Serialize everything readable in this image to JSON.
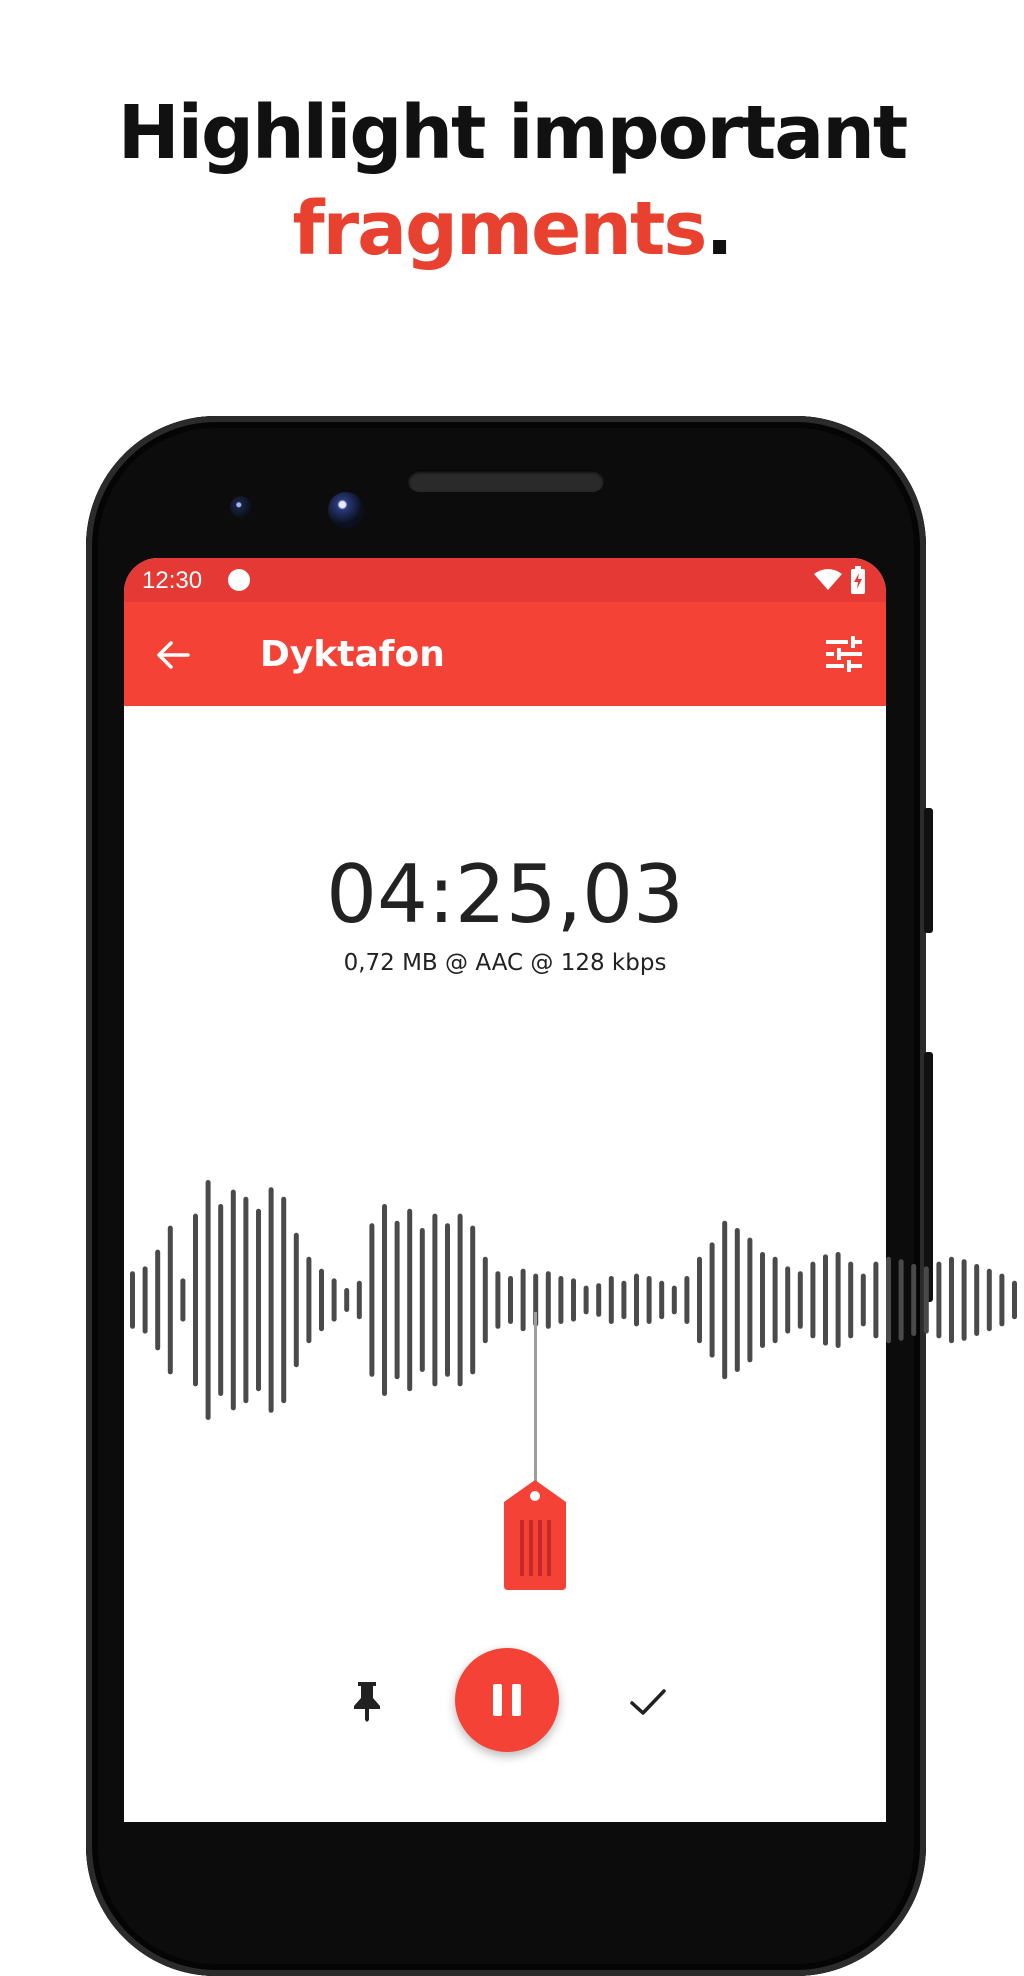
{
  "headline": {
    "line1": "Highlight important",
    "line2_accent": "fragments",
    "line2_suffix": "."
  },
  "status_bar": {
    "time": "12:30",
    "icons": [
      "recording-dot-icon",
      "wifi-icon",
      "battery-charging-icon"
    ]
  },
  "app_bar": {
    "title": "Dyktafon",
    "back_icon": "arrow-left-icon",
    "settings_icon": "tune-sliders-icon"
  },
  "recording": {
    "timer": "04:25,03",
    "info": "0,72 MB @ AAC @ 128 kbps"
  },
  "waveform": {
    "color": "#4a4a4a",
    "amplitudes": [
      0.24,
      0.28,
      0.42,
      0.62,
      0.18,
      0.72,
      1.0,
      0.8,
      0.92,
      0.86,
      0.76,
      0.94,
      0.86,
      0.56,
      0.36,
      0.26,
      0.18,
      0.1,
      0.16,
      0.64,
      0.8,
      0.66,
      0.76,
      0.6,
      0.72,
      0.64,
      0.72,
      0.62,
      0.36,
      0.24,
      0.2,
      0.26,
      0.22,
      0.24,
      0.2,
      0.18,
      0.12,
      0.14,
      0.2,
      0.16,
      0.22,
      0.2,
      0.16,
      0.12,
      0.2,
      0.36,
      0.48,
      0.66,
      0.6,
      0.52,
      0.4,
      0.36,
      0.28,
      0.24,
      0.32,
      0.38,
      0.4,
      0.32,
      0.22,
      0.32,
      0.36,
      0.34,
      0.3,
      0.28,
      0.32,
      0.36,
      0.34,
      0.3,
      0.26,
      0.22,
      0.16,
      0.08
    ]
  },
  "colors": {
    "accent": "#f44336",
    "status_bar": "#e53935",
    "headline_accent": "#e8412f",
    "marker_tag": "#f44336"
  },
  "controls": {
    "left_icon": "pin-icon",
    "center_icon": "pause-icon",
    "right_icon": "check-icon"
  }
}
